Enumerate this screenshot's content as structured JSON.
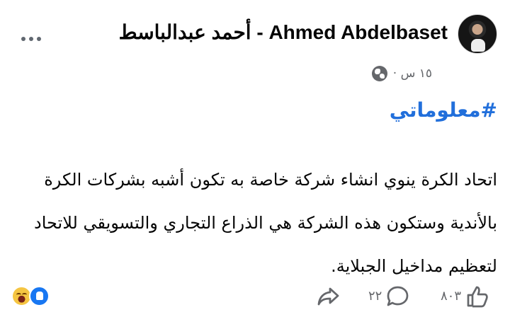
{
  "post": {
    "author": "Ahmed Abdelbaset - أحمد عبدالباسط",
    "timestamp": "١٥ س ·",
    "privacy_icon": "globe-icon",
    "more_icon": "more-options-icon",
    "hashtag": "#معلوماتي",
    "body": "اتحاد الكرة ينوي انشاء شركة خاصة به تكون أشبه بشركات الكرة بالأندية وستكون هذه الشركة هي الذراع التجاري والتسويقي للاتحاد لتعظيم مداخيل الجبلاية."
  },
  "reactions": {
    "icons": [
      "laugh-icon",
      "like-icon"
    ],
    "colors": {
      "like": "#1877f2",
      "laugh": "#f5c542"
    }
  },
  "actions": {
    "like_count": "٨٠٣",
    "comment_count": "٢٢",
    "share_icon": "share-arrow-icon"
  },
  "colors": {
    "text": "#050505",
    "secondary_text": "#65676b",
    "hashtag": "#216fdb"
  }
}
